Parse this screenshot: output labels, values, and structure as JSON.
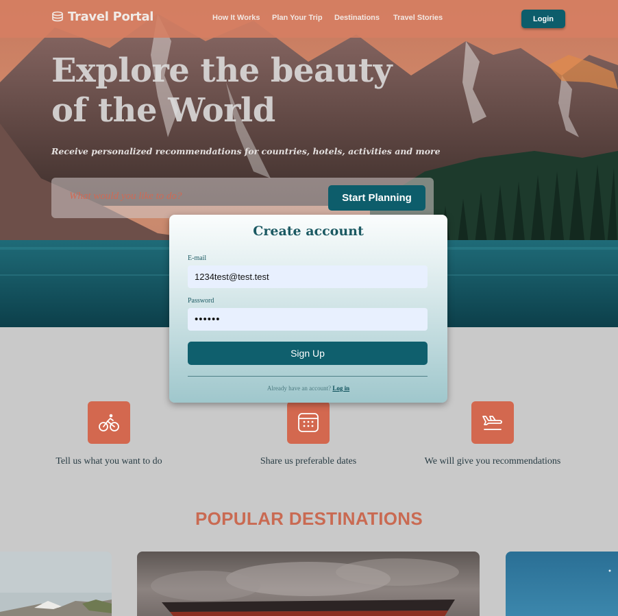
{
  "colors": {
    "brand_teal": "#0d5d6b",
    "accent_orange": "#d3684f",
    "navbar": "#d67e62",
    "autofill_field": "#e8f0fe"
  },
  "navbar": {
    "logo_icon": "coins-stack-icon",
    "logo_text": "Travel Portal",
    "links": [
      "How It Works",
      "Plan Your Trip",
      "Destinations",
      "Travel Stories"
    ],
    "login_label": "Login"
  },
  "hero": {
    "title": "Explore the beauty of the World",
    "subtitle": "Receive personalized recommendations for countries, hotels, activities and more",
    "search_placeholder": "What would you like to do?",
    "plan_button": "Start Planning"
  },
  "modal": {
    "title": "Create account",
    "email_label": "E-mail",
    "email_value": "1234test@test.test",
    "password_label": "Password",
    "password_value": "••••••",
    "signup_button": "Sign Up",
    "footer_text": "Already have an account?",
    "footer_link": "Log in"
  },
  "steps": [
    {
      "icon": "bicycle-icon",
      "label": "Tell us what you want to do"
    },
    {
      "icon": "calendar-icon",
      "label": "Share us preferable dates"
    },
    {
      "icon": "plane-icon",
      "label": "We will give you recommendations"
    }
  ],
  "destinations": {
    "title": "POPULAR DESTINATIONS",
    "cards": [
      "mountain-landscape-image",
      "boat-on-lake-image",
      "blue-sky-image"
    ]
  }
}
